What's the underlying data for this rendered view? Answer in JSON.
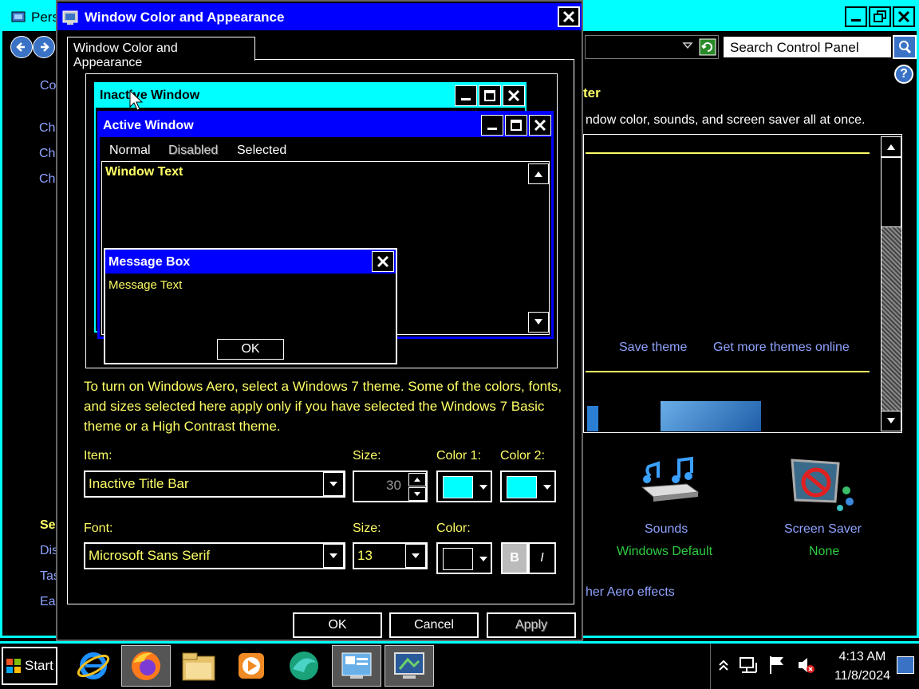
{
  "background_window": {
    "title": "Pers",
    "search_placeholder": "Search Control Panel",
    "left_links": [
      "Co",
      "Ch",
      "Ch",
      "Ch"
    ],
    "see_also_heading": "Se",
    "see_also_links": [
      "Dis",
      "Tas",
      "Ea"
    ],
    "heading_fragment": "ter",
    "description_fragment": "ndow color, sounds, and screen saver all at once.",
    "save_theme": "Save theme",
    "get_more_themes": "Get more themes online",
    "sounds_label": "Sounds",
    "sounds_value": "Windows Default",
    "screensaver_label": "Screen Saver",
    "screensaver_value": "None",
    "aero_link_fragment": "her Aero effects"
  },
  "dialog": {
    "title": "Window Color and Appearance",
    "tab_label": "Window Color and Appearance",
    "preview": {
      "inactive_title": "Inactive Window",
      "active_title": "Active Window",
      "menu_normal": "Normal",
      "menu_disabled": "Disabled",
      "menu_selected": "Selected",
      "window_text": "Window Text",
      "msgbox_title": "Message Box",
      "msgbox_text": "Message Text",
      "msgbox_ok": "OK"
    },
    "info_text": "To turn on Windows Aero, select a Windows 7 theme.  Some of the colors, fonts, and sizes selected here apply only if you have selected the Windows 7 Basic theme or a High Contrast theme.",
    "item_label": "Item:",
    "item_value": "Inactive Title Bar",
    "item_size_label": "Size:",
    "item_size_value": "30",
    "color1_label": "Color 1:",
    "color2_label": "Color 2:",
    "color1_swatch": "#00ffff",
    "color2_swatch": "#00ffff",
    "font_label": "Font:",
    "font_value": "Microsoft Sans Serif",
    "font_size_label": "Size:",
    "font_size_value": "13",
    "font_color_label": "Color:",
    "font_color_swatch": "#000000",
    "bold_label": "B",
    "italic_label": "I",
    "ok_button": "OK",
    "cancel_button": "Cancel",
    "apply_button": "Apply"
  },
  "taskbar": {
    "start_label": "Start",
    "icons": [
      "internet-explorer-icon",
      "firefox-icon",
      "file-explorer-icon",
      "media-player-icon",
      "browser-icon",
      "control-panel-icon",
      "display-settings-icon"
    ],
    "time": "4:13 AM",
    "date": "11/8/2024"
  },
  "colors": {
    "title_active": "#0000ff",
    "title_inactive": "#00ffff",
    "text_yellow": "#ffff66",
    "link_blue": "#8fa3ff",
    "value_green": "#2ecc40"
  }
}
